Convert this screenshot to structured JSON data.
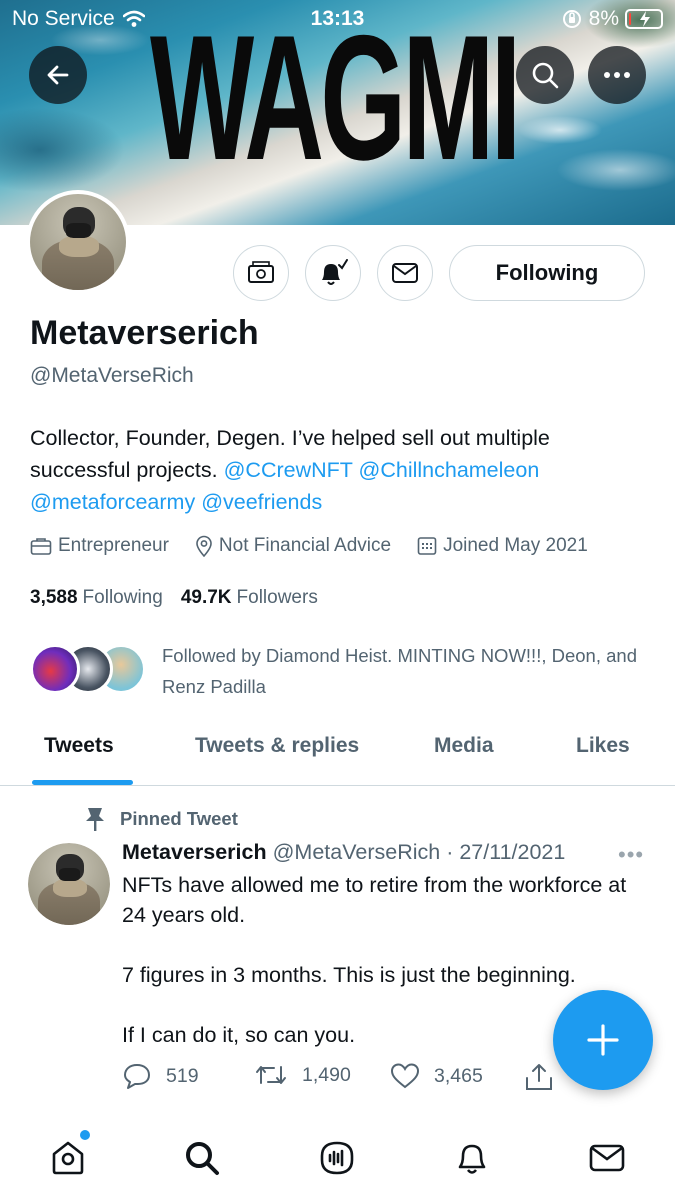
{
  "status_bar": {
    "carrier": "No Service",
    "time": "13:13",
    "battery": "8%",
    "battery_level": 0.08
  },
  "banner": {
    "text": "WAGMI"
  },
  "profile": {
    "name": "Metaverserich",
    "handle": "@MetaVerseRich",
    "bio_text": "Collector, Founder, Degen. I’ve helped sell out multiple successful projects.",
    "bio_links": [
      "@CCrewNFT",
      "@Chillnchameleon",
      "@metaforcearmy",
      "@veefriends"
    ],
    "occupation": "Entrepreneur",
    "location": "Not Financial Advice",
    "joined": "Joined May 2021",
    "following_count": "3,588",
    "following_label": "Following",
    "followers_count": "49.7K",
    "followers_label": "Followers",
    "followed_by": "Followed by Diamond Heist. MINTING NOW!!!, Deon, and Renz Padilla",
    "following_button": "Following"
  },
  "tabs": [
    {
      "label": "Tweets",
      "active": true
    },
    {
      "label": "Tweets & replies",
      "active": false
    },
    {
      "label": "Media",
      "active": false
    },
    {
      "label": "Likes",
      "active": false
    }
  ],
  "pinned_tweet": {
    "pinned_label": "Pinned Tweet",
    "author": "Metaverserich",
    "handle_date": "@MetaVerseRich · 27/11/2021",
    "more": "•••",
    "paragraphs": [
      "NFTs have allowed me to retire from the workforce at 24 years old.",
      "7 figures in 3 months. This is just the beginning.",
      "If I can do it, so can you."
    ],
    "replies": "519",
    "retweets": "1,490",
    "likes": "3,465"
  },
  "icons": {
    "back": "back-arrow-icon",
    "search": "search-icon",
    "more": "more-icon",
    "tip": "tip-jar-icon",
    "notify": "bell-subscribed-icon",
    "message": "envelope-icon",
    "nav": [
      "home-icon",
      "search-icon",
      "spaces-icon",
      "notifications-icon",
      "messages-icon"
    ]
  },
  "colors": {
    "accent": "#1d9bf0",
    "text_primary": "#0f1419",
    "text_secondary": "#536471"
  }
}
